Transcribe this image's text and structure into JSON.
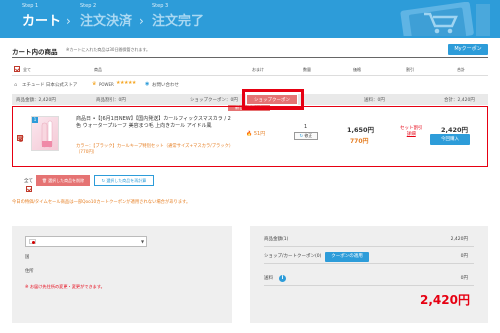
{
  "header": {
    "steps": [
      {
        "no": "Step 1",
        "name": "カート"
      },
      {
        "no": "Step 2",
        "name": "注文決済"
      },
      {
        "no": "Step 3",
        "name": "注文完了"
      }
    ],
    "chevron": "›",
    "bg_color": "#2d9cd9"
  },
  "cart": {
    "title": "カート内の商品",
    "subnote": "※カートに入れた商品は30日間保管されます。",
    "my_coupon_label": "Myクーポン",
    "columns": {
      "all": "全て",
      "product": "商品",
      "bonus": "おまけ",
      "qty": "数量",
      "price": "価格",
      "discount": "割引",
      "total": "合計"
    },
    "store": {
      "name": "エチュード 日本公式ストア",
      "power_label": "POWER",
      "stars": "★★★★★",
      "contact": "お問い合わせ"
    },
    "summary": {
      "product_price": "商品金額：2,420円",
      "product_discount": "商品割引：0円",
      "shop_coupon_label": "ショップクーポン：0円",
      "shop_coupon_button": "ショップクーポン",
      "shipping": "送料：0円",
      "total": "合計：2,420円",
      "new_tag": "新しく適用した"
    },
    "item": {
      "thumb_index": "1",
      "title": "商品日 •【[6月1日NEW】【国内発送】カールフィックスマスカラ / 2色 ウォータープルーフ 美容まつ毛 上向きカール アイドル風",
      "option": "カラー：【ブラック】カールキープ特別セット（通常サイズ+マスカラ/ブラック）（770円）",
      "points": "51円",
      "qty": "1",
      "qty_btn": "修正",
      "price_original": "1,650円",
      "price_option": "770円",
      "discount_label": "セット割引",
      "discount_sub": "詳細",
      "total": "2,420円",
      "buy_label": "今回購入"
    },
    "actions": {
      "all": "全て",
      "delete_selected": "選択した商品を削除",
      "move_selected": "選択した商品を再計算"
    },
    "notice": "今日の特価/タイムセール商品は一部Qoo10カートクーポンが適用されない場合があります。"
  },
  "address": {
    "country_selected": "",
    "country_label": "国",
    "address_label": "住所",
    "note": "※ お届け先住所の変更・変更ができます。"
  },
  "totals": {
    "product_total_label": "商品金額(1)",
    "product_total_value": "2,420円",
    "shop_cart_coupon_label": "ショップ/カートクーポン(0)",
    "coupon_apply_button": "クーポンの適用",
    "coupon_value": "0円",
    "shipping_label": "送料",
    "info_icon": "i",
    "shipping_value": "0円",
    "grand_total": "2,420円"
  },
  "colors": {
    "accent_blue": "#2d9cd9",
    "highlight_red": "#e60012",
    "coupon_pink": "#e57373",
    "orange": "#e67e22"
  }
}
